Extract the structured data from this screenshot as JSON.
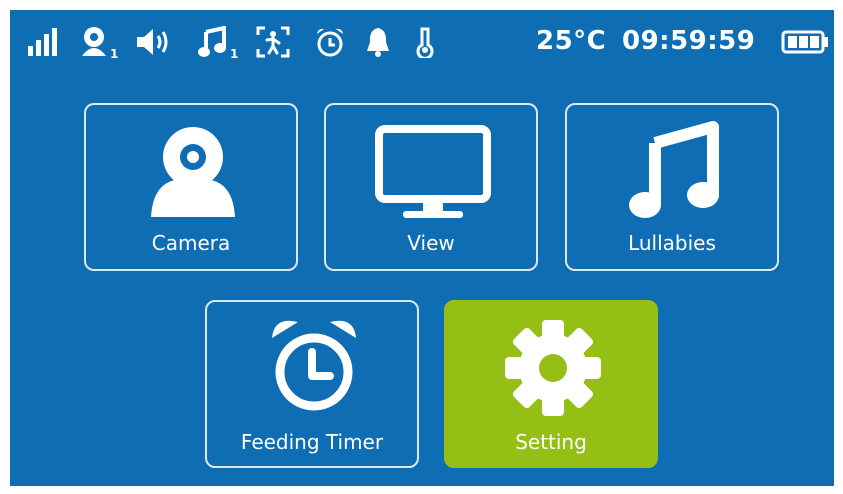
{
  "status_bar": {
    "icons": [
      "signal-icon",
      "camera-icon",
      "volume-icon",
      "music-note-icon",
      "motion-detection-icon",
      "alarm-clock-icon",
      "bell-icon",
      "thermometer-icon",
      "battery-icon"
    ],
    "camera_sub": "1",
    "music_sub": "1",
    "temperature": "25°C",
    "time": "09:59:59"
  },
  "menu": {
    "camera_label": "Camera",
    "view_label": "View",
    "lullabies_label": "Lullabies",
    "feeding_timer_label": "Feeding Timer",
    "setting_label": "Setting",
    "selected": "Setting"
  },
  "colors": {
    "background": "#0f6db4",
    "selected_tile": "#95bf14",
    "foreground": "#ffffff"
  }
}
